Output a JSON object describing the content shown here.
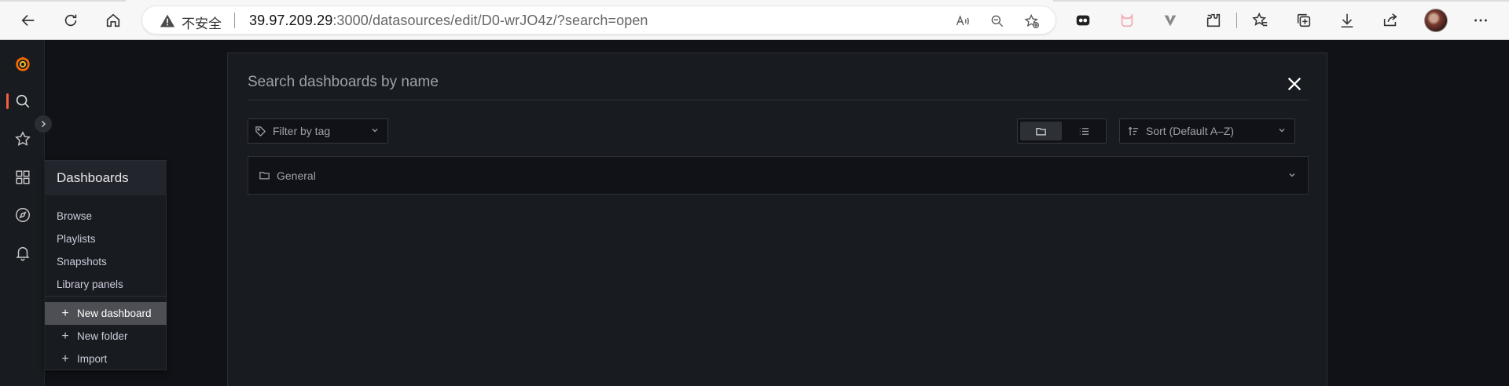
{
  "browser": {
    "address": {
      "insecure_label": "不安全",
      "url_host": "39.97.209.29",
      "url_rest": ":3000/datasources/edit/D0-wrJO4z/?search=open"
    },
    "toolbar_icons": [
      "read-aloud-icon",
      "zoom-out-icon",
      "add-favorite-icon",
      "extension-icon",
      "cat-extension-icon",
      "v-extension-icon",
      "puzzle-icon",
      "favorites-icon",
      "collections-icon",
      "downloads-icon",
      "share-icon",
      "more-icon"
    ]
  },
  "sidebar": {
    "items": [
      "grafana-logo",
      "search",
      "starred",
      "dashboards",
      "explore",
      "alerting"
    ],
    "active": "search"
  },
  "flyout": {
    "title": "Dashboards",
    "links": [
      {
        "label": "Browse"
      },
      {
        "label": "Playlists"
      },
      {
        "label": "Snapshots"
      },
      {
        "label": "Library panels"
      }
    ],
    "actions": [
      {
        "label": "New dashboard",
        "hovered": true
      },
      {
        "label": "New folder"
      },
      {
        "label": "Import"
      }
    ]
  },
  "search": {
    "placeholder": "Search dashboards by name",
    "tag_filter_placeholder": "Filter by tag",
    "layout": "folders",
    "sort_label": "Sort (Default A–Z)",
    "folders": [
      {
        "name": "General"
      }
    ]
  },
  "colors": {
    "accent": "#f55f3e",
    "background": "#111217",
    "panel": "#181b1f"
  }
}
